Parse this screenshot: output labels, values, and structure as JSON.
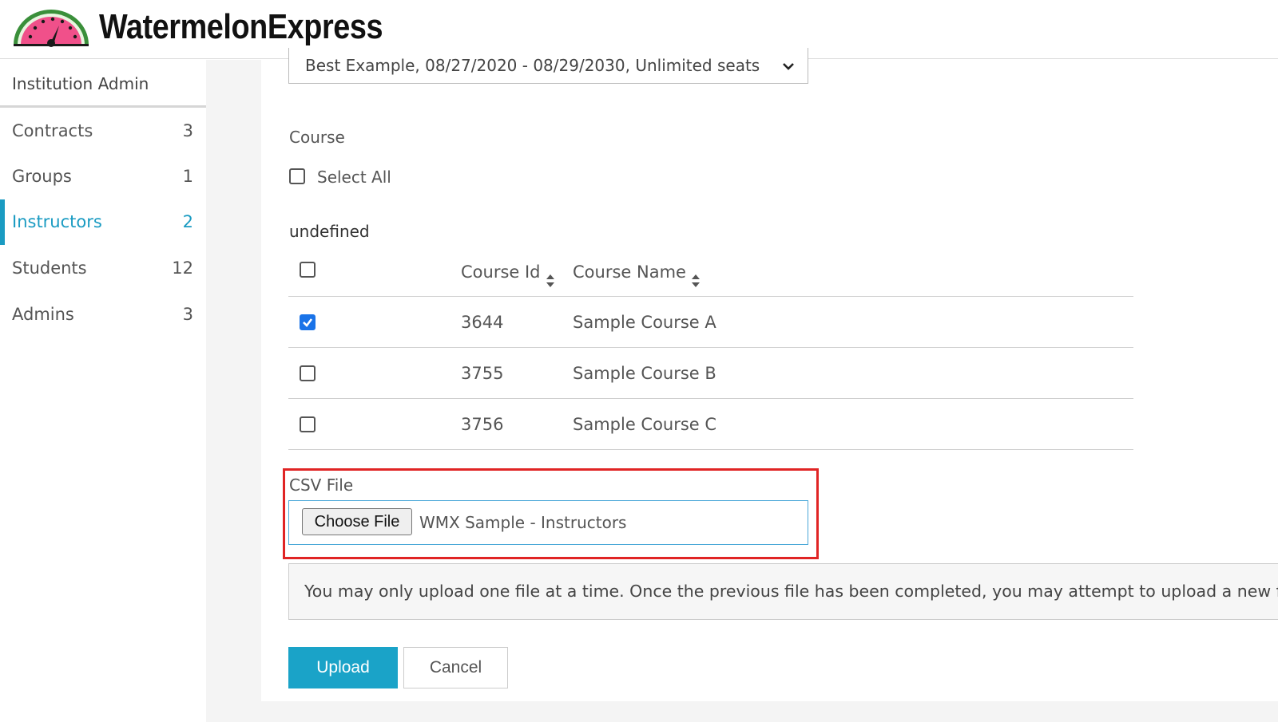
{
  "header": {
    "brand": "WatermelonExpress",
    "logo_icon": "watermelon-speedometer-icon"
  },
  "sidebar": {
    "title": "Institution Admin",
    "accent_color": "#1a9bc2",
    "items": [
      {
        "label": "Contracts",
        "count": "3",
        "active": false
      },
      {
        "label": "Groups",
        "count": "1",
        "active": false
      },
      {
        "label": "Instructors",
        "count": "2",
        "active": true
      },
      {
        "label": "Students",
        "count": "12",
        "active": false
      },
      {
        "label": "Admins",
        "count": "3",
        "active": false
      }
    ]
  },
  "form": {
    "contract_select_value": "Best Example, 08/27/2020 - 08/29/2030, Unlimited seats",
    "course_label": "Course",
    "select_all_label": "Select All",
    "select_all_checked": false,
    "group_heading": "undefined",
    "table": {
      "columns": [
        "Course Id",
        "Course Name"
      ],
      "header_checked": false,
      "rows": [
        {
          "id": "3644",
          "name": "Sample Course A",
          "checked": true
        },
        {
          "id": "3755",
          "name": "Sample Course B",
          "checked": false
        },
        {
          "id": "3756",
          "name": "Sample Course C",
          "checked": false
        }
      ]
    },
    "csv_label": "CSV File",
    "choose_file_label": "Choose File",
    "file_name": "WMX Sample - Instructors",
    "notice": "You may only upload one file at a time. Once the previous file has been completed, you may attempt to upload a new file.",
    "upload_label": "Upload",
    "cancel_label": "Cancel"
  }
}
